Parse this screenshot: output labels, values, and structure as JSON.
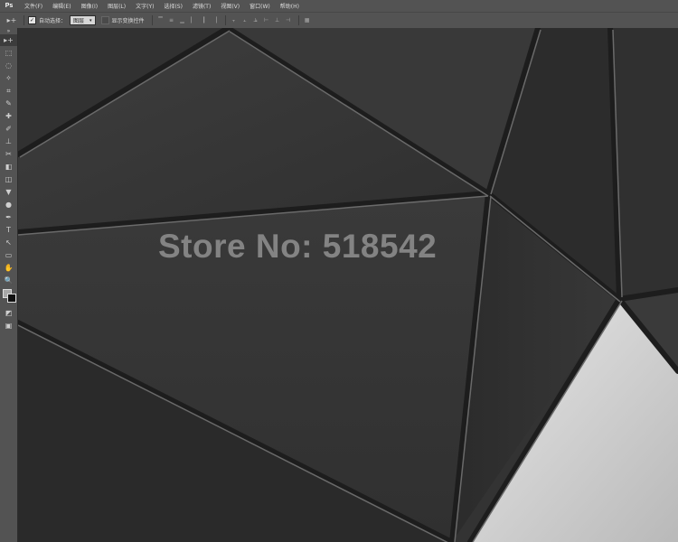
{
  "app": {
    "logo": "Ps"
  },
  "menu": [
    "文件(F)",
    "编辑(E)",
    "图像(I)",
    "图层(L)",
    "文字(Y)",
    "选择(S)",
    "滤镜(T)",
    "视图(V)",
    "窗口(W)",
    "帮助(H)"
  ],
  "options": {
    "tool_glyph": "▸+",
    "auto_select_label": "自动选择：",
    "auto_select_checked": true,
    "auto_select_target": "图层",
    "show_transform_label": "显示变换控件",
    "show_transform_checked": false
  },
  "tools": [
    "▸+",
    "⬚",
    "◌",
    "✧",
    "⌗",
    "✎",
    "✚",
    "✐",
    "⊥",
    "✂",
    "◧",
    "◫",
    "▼",
    "●",
    "✒",
    "T",
    "↖",
    "▭",
    "✋",
    "🔍",
    "◩",
    "▣"
  ],
  "colors": {
    "foreground": "#a8a8a8",
    "background": "#111111",
    "chrome": "#535353"
  },
  "canvas": {
    "watermark": "Store No: 518542"
  }
}
